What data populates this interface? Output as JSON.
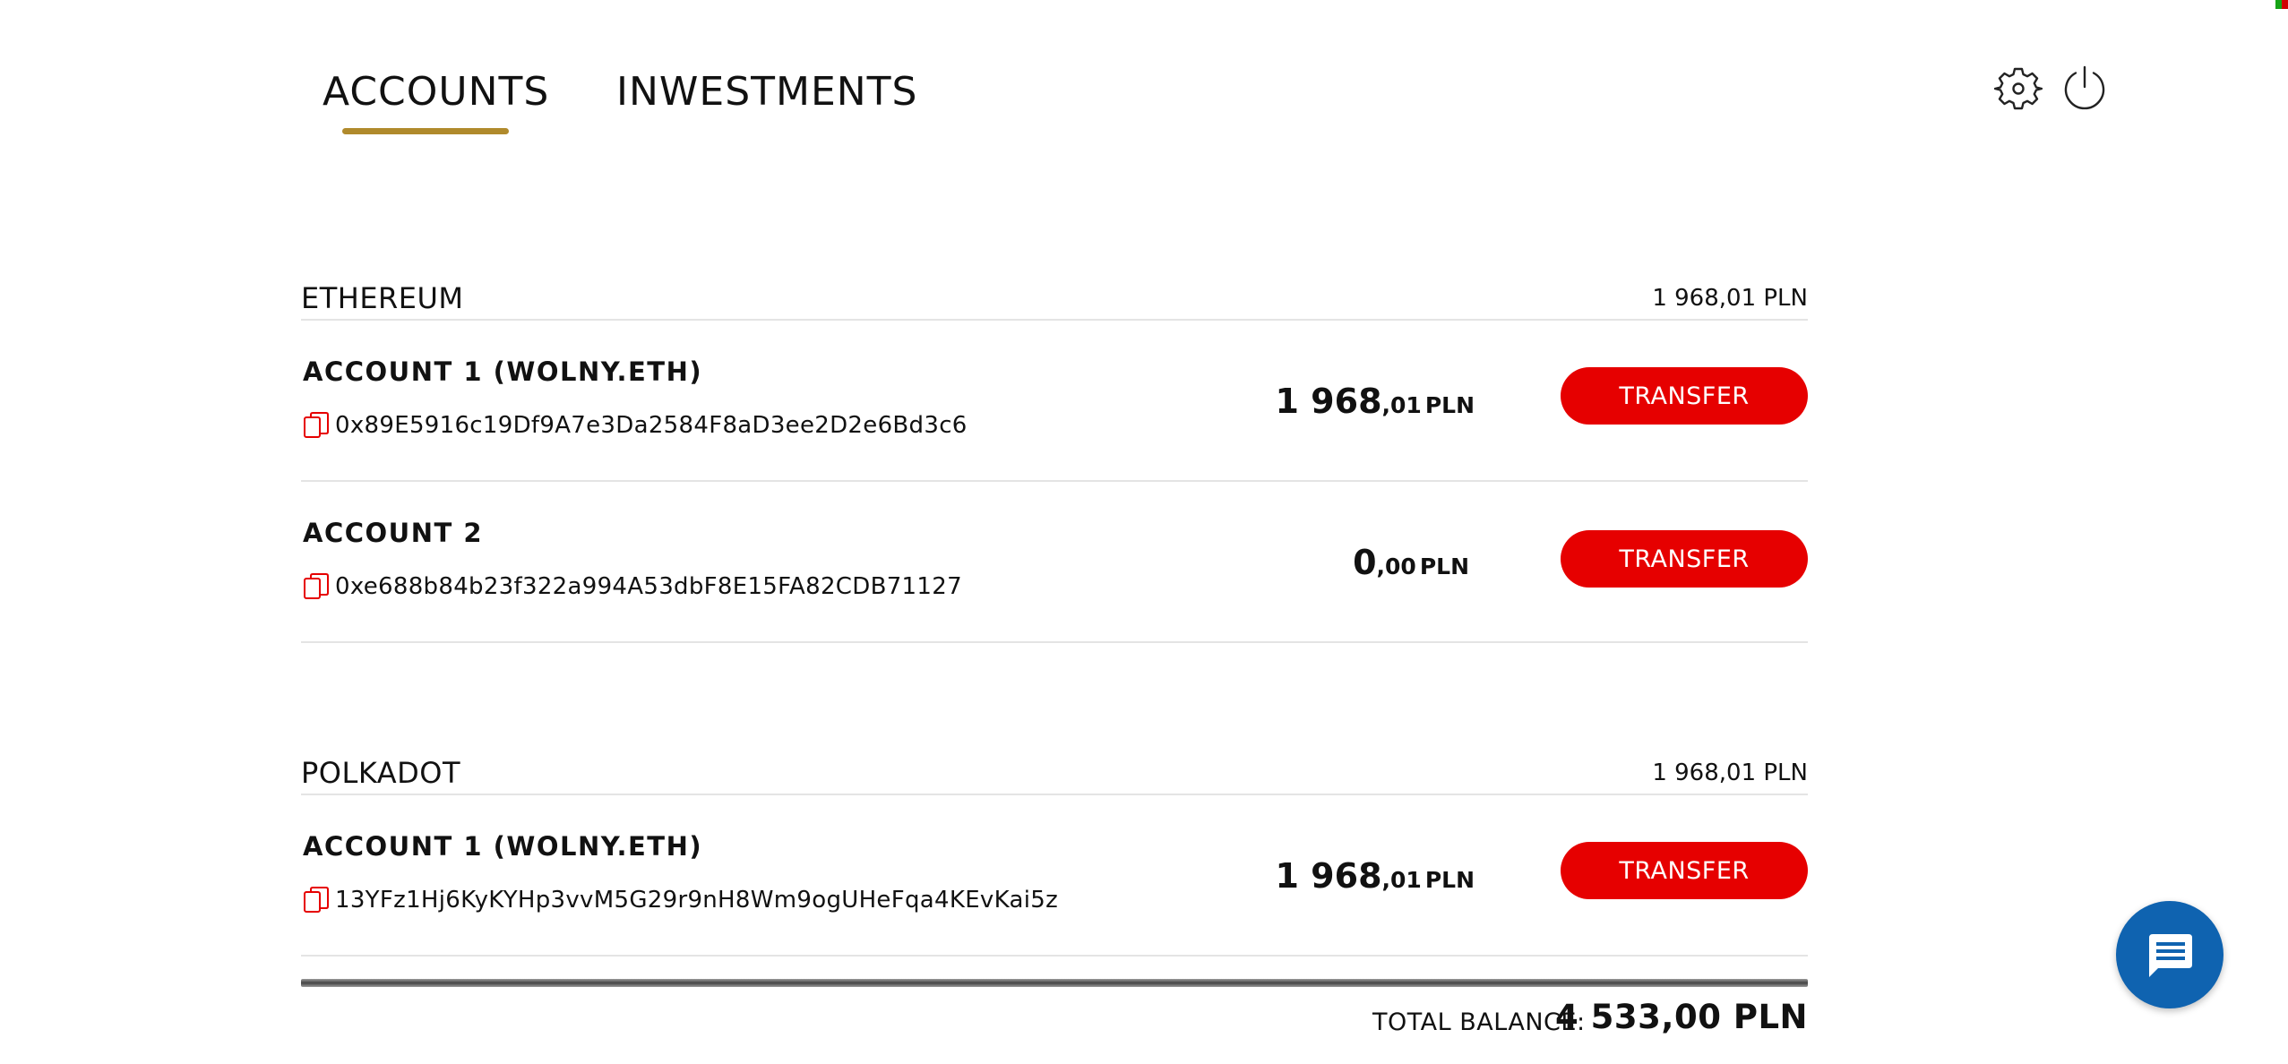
{
  "tabs": {
    "accounts": "ACCOUNTS",
    "investments": "INWESTMENTS"
  },
  "icons": {
    "settings": "gear-icon",
    "logout": "power-icon",
    "copy": "copy-icon",
    "chat": "chat-icon"
  },
  "colors": {
    "accent_underline": "#b08a2c",
    "transfer_button": "#e60000",
    "copy_icon": "#e60000",
    "chat_button": "#0f63b0"
  },
  "sections": [
    {
      "name": "ETHEREUM",
      "total": "1 968,01 PLN",
      "accounts": [
        {
          "name": "ACCOUNT 1 (WOLNY.ETH)",
          "address": "0x89E5916c19Df9A7e3Da2584F8aD3ee2D2e6Bd3c6",
          "amount_int": "1 968",
          "amount_dec": ",01",
          "currency": "PLN",
          "button": "TRANSFER"
        },
        {
          "name": "ACCOUNT 2",
          "address": "0xe688b84b23f322a994A53dbF8E15FA82CDB71127",
          "amount_int": "0",
          "amount_dec": ",00",
          "currency": "PLN",
          "button": "TRANSFER"
        }
      ]
    },
    {
      "name": "POLKADOT",
      "total": "1 968,01 PLN",
      "accounts": [
        {
          "name": "ACCOUNT 1 (WOLNY.ETH)",
          "address": "13YFz1Hj6KyKYHp3vvM5G29r9nH8Wm9ogUHeFqa4KEvKai5z",
          "amount_int": "1 968",
          "amount_dec": ",01",
          "currency": "PLN",
          "button": "TRANSFER"
        }
      ]
    }
  ],
  "total": {
    "label": "TOTAL BALANCE:",
    "value": "4 533,00 PLN"
  }
}
